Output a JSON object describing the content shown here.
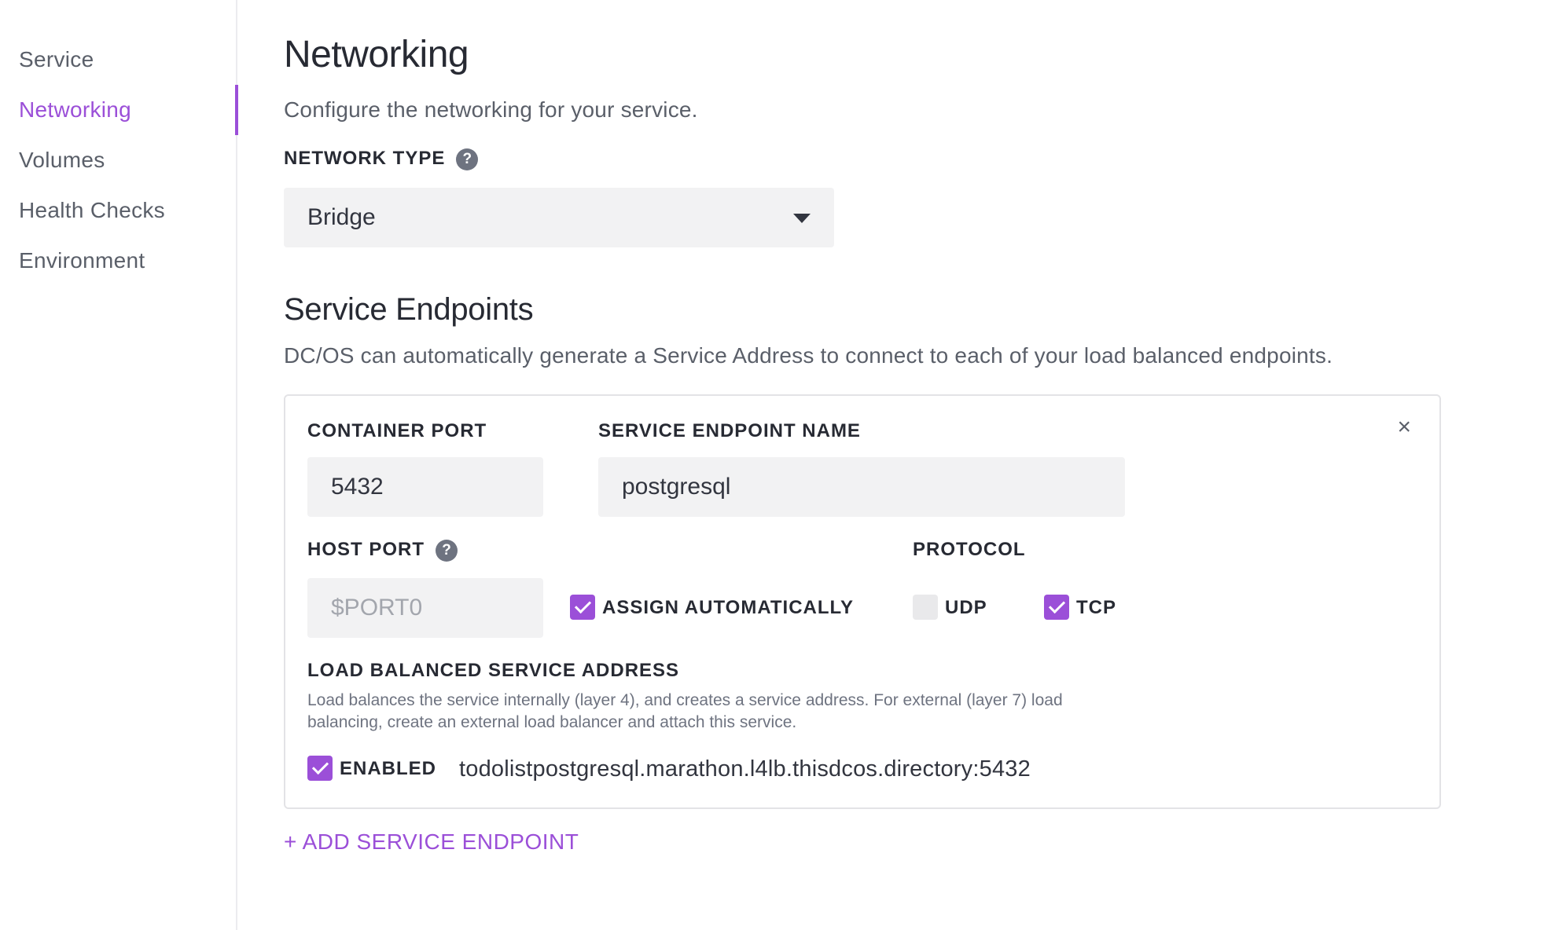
{
  "sidebar": {
    "items": [
      {
        "label": "Service",
        "active": false
      },
      {
        "label": "Networking",
        "active": true
      },
      {
        "label": "Volumes",
        "active": false
      },
      {
        "label": "Health Checks",
        "active": false
      },
      {
        "label": "Environment",
        "active": false
      }
    ]
  },
  "main": {
    "title": "Networking",
    "description": "Configure the networking for your service.",
    "network_type": {
      "label": "NETWORK TYPE",
      "value": "Bridge"
    },
    "endpoints_section": {
      "title": "Service Endpoints",
      "description": "DC/OS can automatically generate a Service Address to connect to each of your load balanced endpoints."
    },
    "endpoint": {
      "container_port_label": "CONTAINER PORT",
      "container_port_value": "5432",
      "name_label": "SERVICE ENDPOINT NAME",
      "name_value": "postgresql",
      "host_port_label": "HOST PORT",
      "host_port_placeholder": "$PORT0",
      "assign_auto_label": "ASSIGN AUTOMATICALLY",
      "assign_auto_checked": true,
      "protocol_label": "PROTOCOL",
      "udp_label": "UDP",
      "udp_checked": false,
      "tcp_label": "TCP",
      "tcp_checked": true,
      "lb_label": "LOAD BALANCED SERVICE ADDRESS",
      "lb_help": "Load balances the service internally (layer 4), and creates a service address. For external (layer 7) load balancing, create an external load balancer and attach this service.",
      "enabled_label": "ENABLED",
      "enabled_checked": true,
      "address": "todolistpostgresql.marathon.l4lb.thisdcos.directory:5432",
      "close_glyph": "×"
    },
    "add_endpoint_label": "+ ADD SERVICE ENDPOINT"
  },
  "colors": {
    "accent": "#9b4fd8",
    "text": "#32353f",
    "muted": "#5a5f69",
    "input_bg": "#f2f2f3"
  },
  "icons": {
    "help": "question-circle-icon",
    "caret": "caret-down-icon",
    "close": "close-icon",
    "check": "checkmark-icon"
  }
}
